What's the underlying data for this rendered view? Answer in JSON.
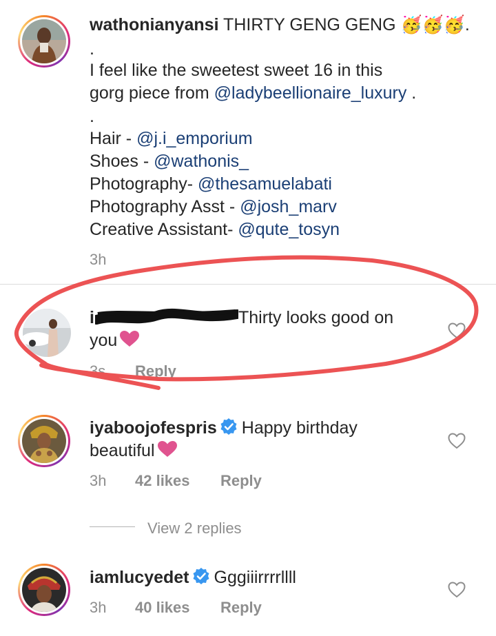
{
  "colors": {
    "mention": "#1b3f75",
    "meta": "#8e8e8e",
    "verified": "#3897f0",
    "heart": "#e0538f",
    "annotation": "#ec5354"
  },
  "caption": {
    "username": "wathonianyansi",
    "title_text": "THIRTY GENG GENG ",
    "title_emoji": "🥳🥳🥳.",
    "dot1": ".",
    "line1": "I feel like the sweetest sweet 16 in this",
    "line2_prefix": "gorg piece from ",
    "line2_mention": "@ladybeellionaire_luxury",
    "line2_suffix": " .",
    "dot2": ".",
    "credits": [
      {
        "label": "Hair - ",
        "mention": "@j.i_emporium"
      },
      {
        "label": "Shoes - ",
        "mention": "@wathonis_"
      },
      {
        "label": "Photography- ",
        "mention": "@thesamuelabati"
      },
      {
        "label": "Photography Asst - ",
        "mention": "@josh_marv"
      },
      {
        "label": "Creative Assistant- ",
        "mention": "@qute_tosyn"
      }
    ],
    "time": "3h"
  },
  "comments": [
    {
      "username_visible": "i",
      "text_line1": "Thirty looks good on",
      "text_line2": "you",
      "emoji": "heart",
      "time": "3s",
      "reply_label": "Reply"
    },
    {
      "username": "iyaboojofespris",
      "verified": true,
      "text_line1": "Happy birthday",
      "text_line2": "beautiful",
      "emoji": "heart",
      "time": "3h",
      "likes": "42 likes",
      "reply_label": "Reply",
      "view_replies": "View 2 replies"
    },
    {
      "username": "iamlucyedet",
      "verified": true,
      "text_line1": "Gggiiirrrrllll",
      "time": "3h",
      "likes": "40 likes",
      "reply_label": "Reply"
    }
  ]
}
